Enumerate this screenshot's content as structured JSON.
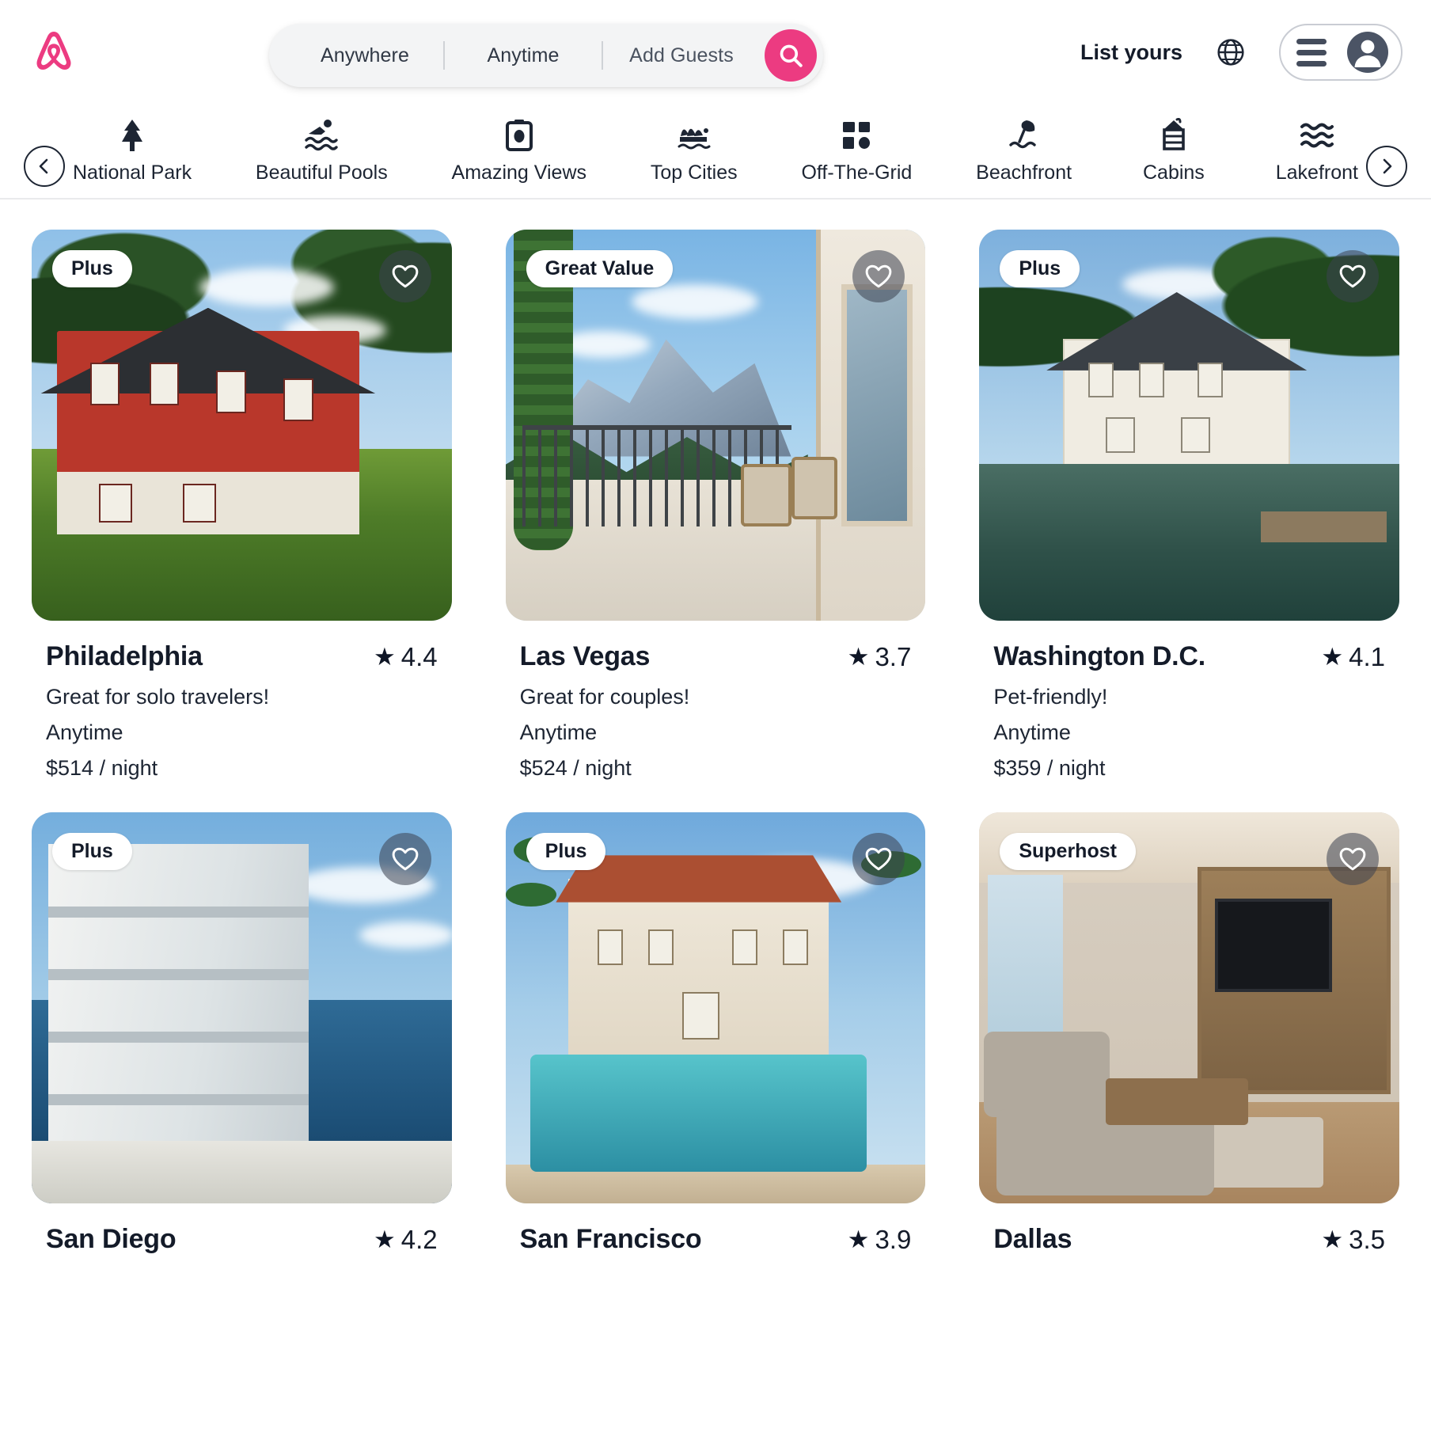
{
  "header": {
    "logo_icon": "airbnb-logo-icon",
    "brand_color": "#ec3b81",
    "search": {
      "where": "Anywhere",
      "when": "Anytime",
      "guests": "Add Guests",
      "search_icon": "search-icon"
    },
    "list_yours_label": "List yours",
    "globe_icon": "globe-icon",
    "menu_icon": "hamburger-menu-icon",
    "avatar_icon": "user-avatar-icon"
  },
  "categories": {
    "prev_icon": "chevron-left-icon",
    "next_icon": "chevron-right-icon",
    "items": [
      {
        "label": "National Park",
        "icon": "pine-tree-icon"
      },
      {
        "label": "Beautiful Pools",
        "icon": "swimmer-waves-icon"
      },
      {
        "label": "Amazing Views",
        "icon": "camera-icon"
      },
      {
        "label": "Top Cities",
        "icon": "opera-house-icon"
      },
      {
        "label": "Off-The-Grid",
        "icon": "grid-blocks-icon"
      },
      {
        "label": "Beachfront",
        "icon": "beach-umbrella-icon"
      },
      {
        "label": "Cabins",
        "icon": "cabin-house-icon"
      },
      {
        "label": "Lakefront",
        "icon": "water-waves-icon"
      }
    ]
  },
  "listings": [
    {
      "badge": "Plus",
      "title": "Philadelphia",
      "rating": "4.4",
      "star_icon": "star-icon",
      "subtitle": "Great for solo travelers!",
      "availability": "Anytime",
      "price": "$514 / night",
      "heart_icon": "heart-outline-icon",
      "scene": "philadelphia"
    },
    {
      "badge": "Great Value",
      "title": "Las Vegas",
      "rating": "3.7",
      "star_icon": "star-icon",
      "subtitle": "Great for couples!",
      "availability": "Anytime",
      "price": "$524 / night",
      "heart_icon": "heart-outline-icon",
      "scene": "lasvegas"
    },
    {
      "badge": "Plus",
      "title": "Washington D.C.",
      "rating": "4.1",
      "star_icon": "star-icon",
      "subtitle": "Pet-friendly!",
      "availability": "Anytime",
      "price": "$359 / night",
      "heart_icon": "heart-outline-icon",
      "scene": "washington"
    },
    {
      "badge": "Plus",
      "title": "San Diego",
      "rating": "4.2",
      "star_icon": "star-icon",
      "subtitle": "",
      "availability": "",
      "price": "",
      "heart_icon": "heart-outline-icon",
      "scene": "sandiego"
    },
    {
      "badge": "Plus",
      "title": "San Francisco",
      "rating": "3.9",
      "star_icon": "star-icon",
      "subtitle": "",
      "availability": "",
      "price": "",
      "heart_icon": "heart-outline-icon",
      "scene": "sanfrancisco"
    },
    {
      "badge": "Superhost",
      "title": "Dallas",
      "rating": "3.5",
      "star_icon": "star-icon",
      "subtitle": "",
      "availability": "",
      "price": "",
      "heart_icon": "heart-outline-icon",
      "scene": "dallas"
    }
  ]
}
